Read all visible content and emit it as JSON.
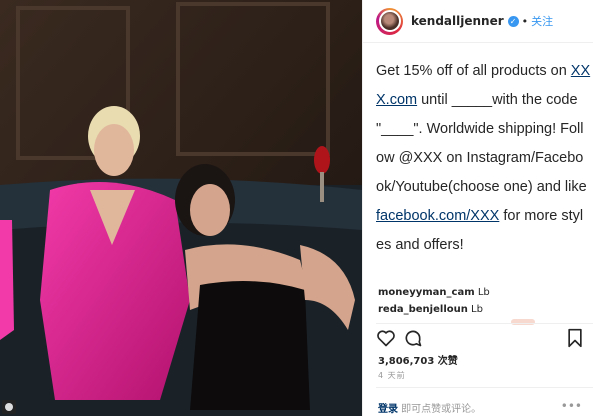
{
  "post": {
    "username": "kendalljenner",
    "follow_label": "关注",
    "dot": "•",
    "verified_mark": "✓"
  },
  "caption": {
    "line1": "Get 15% off of all products on ",
    "link1": "XXX.com",
    "line2": " until _____with the code \"____\". Worldwide shipping! Follow @XXX on Instagram/Facebook/Youtube(choose one) and like ",
    "link2": "facebook.com/XXX",
    "line3": " for more styles and offers!"
  },
  "comments": [
    {
      "user": "moneyyman_cam",
      "text": "Lb"
    },
    {
      "user": "reda_benjelloun",
      "text": "Lb"
    }
  ],
  "likes": "3,806,703 次赞",
  "time": "4 天前",
  "footer": {
    "login": "登录",
    "rest": " 即可点赞或评论。",
    "more": "•••"
  },
  "icons": [
    "heart-icon",
    "comment-icon",
    "bookmark-icon",
    "more-icon"
  ],
  "colors": {
    "link": "#003569",
    "accent": "#3897f0",
    "muted": "#999999"
  }
}
